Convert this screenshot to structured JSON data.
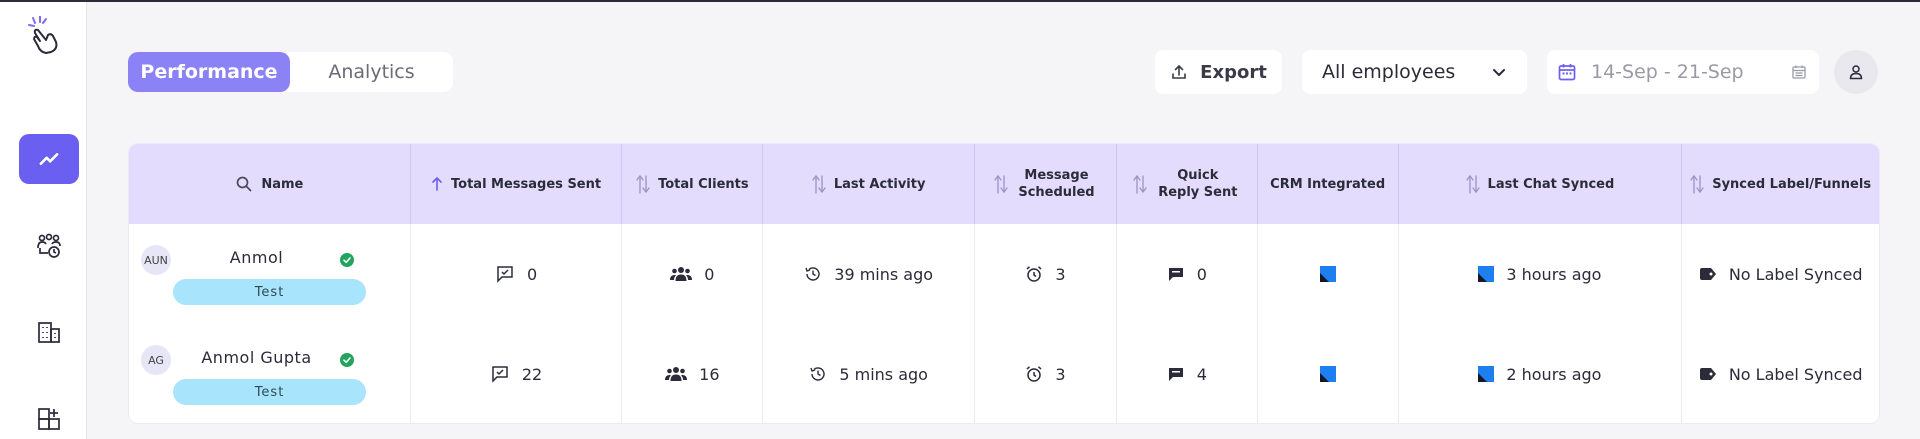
{
  "tabs": {
    "performance": "Performance",
    "analytics": "Analytics"
  },
  "toolbar": {
    "export_label": "Export",
    "employee_filter": "All employees",
    "date_range": "14-Sep - 21-Sep"
  },
  "table": {
    "columns": {
      "name": "Name",
      "total_messages": "Total Messages Sent",
      "total_clients": "Total Clients",
      "last_activity": "Last Activity",
      "message_scheduled": "Message Scheduled",
      "quick_reply": "Quick Reply Sent",
      "crm": "CRM Integrated",
      "last_chat": "Last Chat Synced",
      "synced_label": "Synced Label/Funnels"
    },
    "rows": [
      {
        "initials": "AUN",
        "name": "Anmol",
        "tag": "Test",
        "messages": "0",
        "clients": "0",
        "last_activity": "39 mins ago",
        "scheduled": "3",
        "quick_reply": "0",
        "last_chat": "3 hours ago",
        "label": "No Label Synced"
      },
      {
        "initials": "AG",
        "name": "Anmol Gupta",
        "tag": "Test",
        "messages": "22",
        "clients": "16",
        "last_activity": "5 mins ago",
        "scheduled": "3",
        "quick_reply": "4",
        "last_chat": "2 hours ago",
        "label": "No Label Synced"
      }
    ]
  },
  "colors": {
    "accent": "#6a5ff0",
    "tab_active": "#8a82f5",
    "header_bg": "#e3dcfd",
    "tag_bg": "#a8e4fb",
    "verified": "#22a45d"
  }
}
